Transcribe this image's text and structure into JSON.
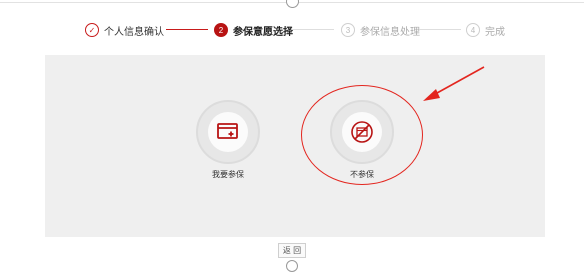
{
  "stepper": {
    "steps": [
      {
        "num": "✓",
        "label": "个人信息确认",
        "state": "done"
      },
      {
        "num": "2",
        "label": "参保意愿选择",
        "state": "active"
      },
      {
        "num": "3",
        "label": "参保信息处理",
        "state": "todo"
      },
      {
        "num": "4",
        "label": "完成",
        "state": "todo"
      }
    ]
  },
  "options": {
    "enroll": {
      "label": "我要参保",
      "icon": "enroll-card-plus-icon"
    },
    "decline": {
      "label": "不参保",
      "icon": "decline-no-card-icon"
    }
  },
  "actions": {
    "back_label": "返 回"
  },
  "colors": {
    "accent": "#b81414",
    "annotation": "#e3261f",
    "panel_bg": "#efefef"
  }
}
